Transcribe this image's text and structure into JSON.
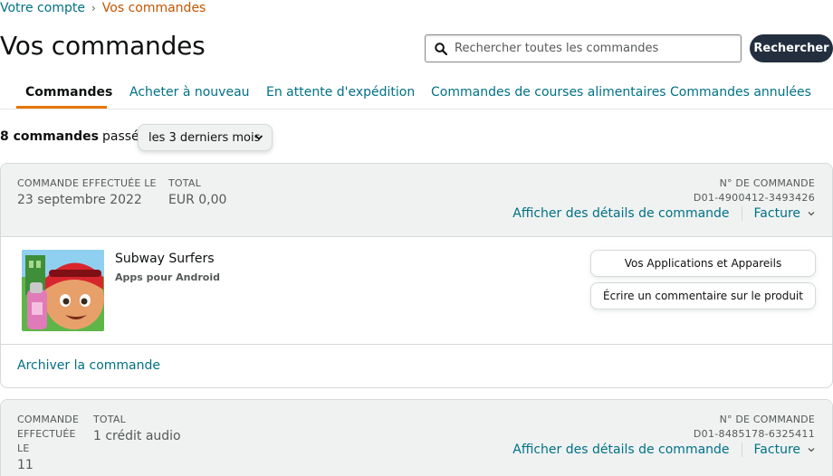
{
  "breadcrumb": {
    "root": "Votre compte",
    "current": "Vos commandes"
  },
  "page_title": "Vos commandes",
  "search": {
    "placeholder": "Rechercher toutes les commandes",
    "button_label": "Rechercher",
    "icon": "search-icon"
  },
  "tabs": [
    {
      "label": "Commandes",
      "active": true
    },
    {
      "label": "Acheter à nouveau",
      "active": false
    },
    {
      "label": "En attente d'expédition",
      "active": false
    },
    {
      "label": "Commandes de courses alimentaires",
      "active": false
    },
    {
      "label": "Commandes annulées",
      "active": false
    }
  ],
  "filter": {
    "count": "8 commandes",
    "suffix": "passées",
    "period": "les 3 derniers mois"
  },
  "orders": [
    {
      "date_label": "COMMANDE EFFECTUÉE LE",
      "date": "23 septembre 2022",
      "total_label": "TOTAL",
      "total": "EUR 0,00",
      "order_number_label": "N° DE COMMANDE",
      "order_number": "D01-4900412-3493426",
      "details_link": "Afficher des détails de commande",
      "invoice_link": "Facture",
      "product": {
        "title": "Subway Surfers",
        "subtitle": "Apps pour Android"
      },
      "actions": [
        "Vos Applications et Appareils",
        "Écrire un commentaire sur le produit"
      ],
      "archive_link": "Archiver la commande"
    },
    {
      "date_label": "COMMANDE EFFECTUÉE LE",
      "date": "11",
      "total_label": "TOTAL",
      "total": "1 crédit audio",
      "order_number_label": "N° DE COMMANDE",
      "order_number": "D01-8485178-6325411",
      "details_link": "Afficher des détails de commande",
      "invoice_link": "Facture"
    }
  ],
  "colors": {
    "link": "#007185",
    "current": "#c45500",
    "accent_tab": "#e77600",
    "button_dark": "#232f3e",
    "header_bg": "#f0f2f2"
  }
}
